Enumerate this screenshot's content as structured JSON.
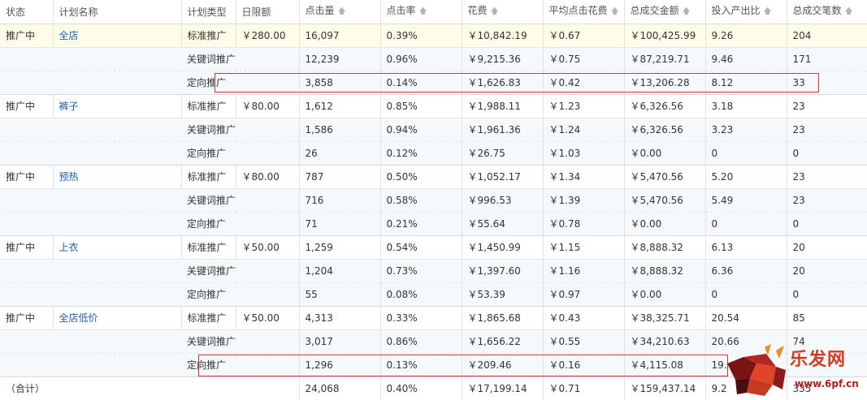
{
  "headers": {
    "status": "状态",
    "plan_name": "计划名称",
    "plan_type": "计划类型",
    "daily_limit": "日限额",
    "clicks": "点击量",
    "ctr": "点击率",
    "cost": "花费",
    "avg_cpc": "平均点击花费",
    "total_gmv": "总成交金额",
    "roi": "投入产出比",
    "total_orders": "总成交笔数"
  },
  "plans": [
    {
      "status": "推广中",
      "name": "全店",
      "type": "标准推广",
      "limit": "￥280.00",
      "clicks": "16,097",
      "ctr": "0.39%",
      "cost": "￥10,842.19",
      "cpc": "￥0.67",
      "gmv": "￥100,425.99",
      "roi": "9.26",
      "orders": "204",
      "kw": {
        "label": "关键词推广",
        "clicks": "12,239",
        "ctr": "0.96%",
        "cost": "￥9,215.36",
        "cpc": "￥0.75",
        "gmv": "￥87,219.71",
        "roi": "9.46",
        "orders": "171"
      },
      "tg": {
        "label": "定向推广",
        "clicks": "3,858",
        "ctr": "0.14%",
        "cost": "￥1,626.83",
        "cpc": "￥0.42",
        "gmv": "￥13,206.28",
        "roi": "8.12",
        "orders": "33"
      }
    },
    {
      "status": "推广中",
      "name": "裤子",
      "type": "标准推广",
      "limit": "￥80.00",
      "clicks": "1,612",
      "ctr": "0.85%",
      "cost": "￥1,988.11",
      "cpc": "￥1.23",
      "gmv": "￥6,326.56",
      "roi": "3.18",
      "orders": "23",
      "kw": {
        "label": "关键词推广",
        "clicks": "1,586",
        "ctr": "0.94%",
        "cost": "￥1,961.36",
        "cpc": "￥1.24",
        "gmv": "￥6,326.56",
        "roi": "3.23",
        "orders": "23"
      },
      "tg": {
        "label": "定向推广",
        "clicks": "26",
        "ctr": "0.12%",
        "cost": "￥26.75",
        "cpc": "￥1.03",
        "gmv": "￥0.00",
        "roi": "0",
        "orders": "0"
      }
    },
    {
      "status": "推广中",
      "name": "预热",
      "type": "标准推广",
      "limit": "￥80.00",
      "clicks": "787",
      "ctr": "0.50%",
      "cost": "￥1,052.17",
      "cpc": "￥1.34",
      "gmv": "￥5,470.56",
      "roi": "5.20",
      "orders": "23",
      "kw": {
        "label": "关键词推广",
        "clicks": "716",
        "ctr": "0.58%",
        "cost": "￥996.53",
        "cpc": "￥1.39",
        "gmv": "￥5,470.56",
        "roi": "5.49",
        "orders": "23"
      },
      "tg": {
        "label": "定向推广",
        "clicks": "71",
        "ctr": "0.21%",
        "cost": "￥55.64",
        "cpc": "￥0.78",
        "gmv": "￥0.00",
        "roi": "0",
        "orders": "0"
      }
    },
    {
      "status": "推广中",
      "name": "上衣",
      "type": "标准推广",
      "limit": "￥50.00",
      "clicks": "1,259",
      "ctr": "0.54%",
      "cost": "￥1,450.99",
      "cpc": "￥1.15",
      "gmv": "￥8,888.32",
      "roi": "6.13",
      "orders": "20",
      "kw": {
        "label": "关键词推广",
        "clicks": "1,204",
        "ctr": "0.73%",
        "cost": "￥1,397.60",
        "cpc": "￥1.16",
        "gmv": "￥8,888.32",
        "roi": "6.36",
        "orders": "20"
      },
      "tg": {
        "label": "定向推广",
        "clicks": "55",
        "ctr": "0.08%",
        "cost": "￥53.39",
        "cpc": "￥0.97",
        "gmv": "￥0.00",
        "roi": "0",
        "orders": "0"
      }
    },
    {
      "status": "推广中",
      "name": "全店低价",
      "type": "标准推广",
      "limit": "￥50.00",
      "clicks": "4,313",
      "ctr": "0.33%",
      "cost": "￥1,865.68",
      "cpc": "￥0.43",
      "gmv": "￥38,325.71",
      "roi": "20.54",
      "orders": "85",
      "kw": {
        "label": "关键词推广",
        "clicks": "3,017",
        "ctr": "0.86%",
        "cost": "￥1,656.22",
        "cpc": "￥0.55",
        "gmv": "￥34,210.63",
        "roi": "20.66",
        "orders": "74"
      },
      "tg": {
        "label": "定向推广",
        "clicks": "1,296",
        "ctr": "0.13%",
        "cost": "￥209.46",
        "cpc": "￥0.16",
        "gmv": "￥4,115.08",
        "roi": "19.",
        "orders": ""
      }
    }
  ],
  "total": {
    "label": "（合计）",
    "clicks": "24,068",
    "ctr": "0.40%",
    "cost": "￥17,199.14",
    "cpc": "￥0.71",
    "gmv": "￥159,437.14",
    "roi": "9.2",
    "orders": "335"
  },
  "watermark": {
    "text": "乐发网",
    "url": "www.6pf.cn"
  },
  "colors": {
    "link": "#1f5fa8",
    "highlight_box": "#d9323a",
    "first_row_bg": "#fffde8",
    "sub_row_bg": "#f6f9fc"
  },
  "icons": {
    "sort": "sort-arrow-up-icon"
  }
}
